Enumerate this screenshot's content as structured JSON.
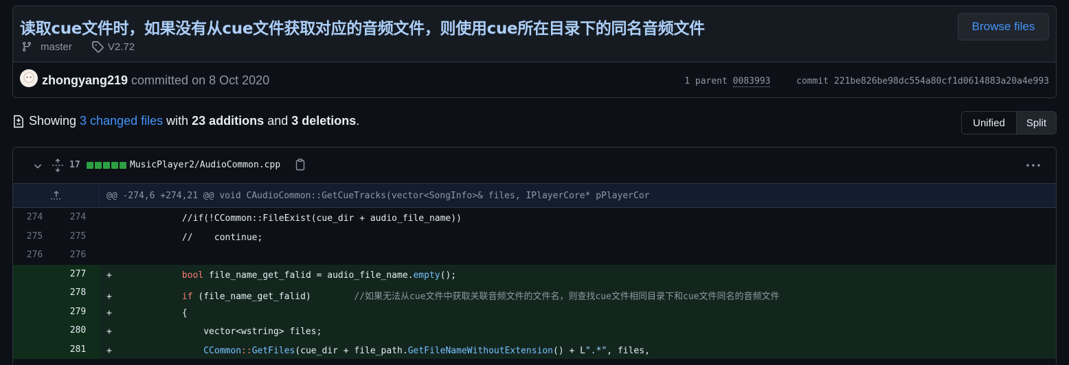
{
  "commit": {
    "title": "读取cue文件时，如果没有从cue文件获取对应的音频文件，则使用cue所在目录下的同名音频文件",
    "branch": "master",
    "tag": "V2.72",
    "browse_label": "Browse files",
    "author": "zhongyang219",
    "committed_text": "committed on 8 Oct 2020",
    "parent_label": "1 parent",
    "parent_sha": "0083993",
    "commit_label": "commit",
    "commit_sha": "221be826be98dc554a80cf1d0614883a20a4e993"
  },
  "summary": {
    "showing": "Showing",
    "changed_files": "3 changed files",
    "with": "with",
    "additions": "23 additions",
    "and": "and",
    "deletions": "3 deletions",
    "period": "."
  },
  "view_toggle": {
    "unified": "Unified",
    "split": "Split"
  },
  "file": {
    "change_count": "17",
    "path": "MusicPlayer2/AudioCommon.cpp",
    "hunk_header": "@@ -274,6 +274,21 @@ void CAudioCommon::GetCueTracks(vector<SongInfo>& files, IPlayerCore* pPlayerCor"
  },
  "lines": [
    {
      "type": "ctx",
      "old": "274",
      "new": "274",
      "sign": "",
      "code": "            //if(!CCommon::FileExist(cue_dir + audio_file_name))"
    },
    {
      "type": "ctx",
      "old": "275",
      "new": "275",
      "sign": "",
      "code": "            //    continue;"
    },
    {
      "type": "ctx",
      "old": "276",
      "new": "276",
      "sign": "",
      "code": ""
    },
    {
      "type": "add",
      "old": "",
      "new": "277",
      "sign": "+",
      "code": ""
    },
    {
      "type": "add",
      "old": "",
      "new": "278",
      "sign": "+",
      "code": ""
    },
    {
      "type": "add",
      "old": "",
      "new": "279",
      "sign": "+",
      "code": "            {"
    },
    {
      "type": "add",
      "old": "",
      "new": "280",
      "sign": "+",
      "code": "                vector<wstring> files;"
    },
    {
      "type": "add",
      "old": "",
      "new": "281",
      "sign": "+",
      "code": ""
    }
  ],
  "code_tokens": {
    "l277_kw": "bool",
    "l277_a": " file_name_get_falid = audio_file_name.",
    "l277_fn": "empty",
    "l277_b": "();",
    "l278_kw": "if",
    "l278_a": " (file_name_get_falid)        ",
    "l278_cmt": "//如果无法从cue文件中获取关联音频文件的文件名，则查找cue文件相同目录下和cue文件同名的音频文件",
    "l281_cls": "CCommon",
    "l281_sep": "::",
    "l281_fn1": "GetFiles",
    "l281_a": "(cue_dir + file_path.",
    "l281_fn2": "GetFileNameWithoutExtension",
    "l281_b": "() + L",
    "l281_str": "\".*\"",
    "l281_c": ", files,"
  },
  "icons": [
    "git-branch-icon",
    "tag-icon",
    "file-diff-icon",
    "chevron-down-icon",
    "expand-icon",
    "copy-icon",
    "kebab-icon",
    "expand-up-icon"
  ]
}
